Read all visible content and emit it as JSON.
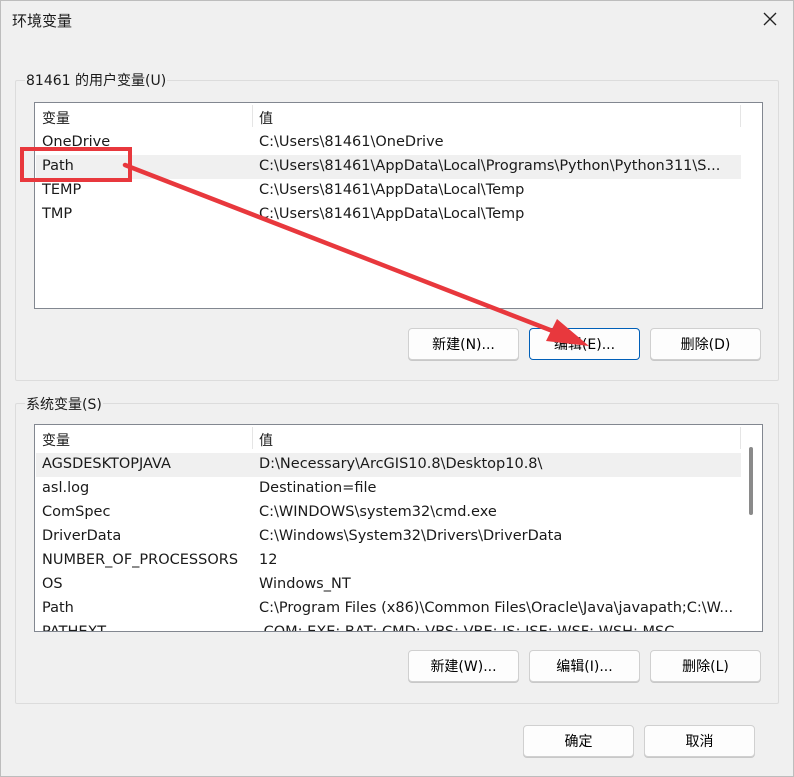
{
  "window": {
    "title": "环境变量"
  },
  "user_vars": {
    "group_label": "81461 的用户变量(U)",
    "columns": [
      "变量",
      "值"
    ],
    "rows": [
      {
        "name": "OneDrive",
        "value": "C:\\Users\\81461\\OneDrive"
      },
      {
        "name": "Path",
        "value": "C:\\Users\\81461\\AppData\\Local\\Programs\\Python\\Python311\\S..."
      },
      {
        "name": "TEMP",
        "value": "C:\\Users\\81461\\AppData\\Local\\Temp"
      },
      {
        "name": "TMP",
        "value": "C:\\Users\\81461\\AppData\\Local\\Temp"
      }
    ],
    "buttons": {
      "new": "新建(N)...",
      "edit": "编辑(E)...",
      "delete": "删除(D)"
    }
  },
  "system_vars": {
    "group_label": "系统变量(S)",
    "columns": [
      "变量",
      "值"
    ],
    "rows": [
      {
        "name": "AGSDESKTOPJAVA",
        "value": "D:\\Necessary\\ArcGIS10.8\\Desktop10.8\\"
      },
      {
        "name": "asl.log",
        "value": "Destination=file"
      },
      {
        "name": "ComSpec",
        "value": "C:\\WINDOWS\\system32\\cmd.exe"
      },
      {
        "name": "DriverData",
        "value": "C:\\Windows\\System32\\Drivers\\DriverData"
      },
      {
        "name": "NUMBER_OF_PROCESSORS",
        "value": "12"
      },
      {
        "name": "OS",
        "value": "Windows_NT"
      },
      {
        "name": "Path",
        "value": "C:\\Program Files (x86)\\Common Files\\Oracle\\Java\\javapath;C:\\W..."
      },
      {
        "name": "PATHEXT",
        "value": ".COM;.EXE;.BAT;.CMD;.VBS;.VBE;.JS;.JSE;.WSF;.WSH;.MSC"
      }
    ],
    "buttons": {
      "new": "新建(W)...",
      "edit": "编辑(I)...",
      "delete": "删除(L)"
    }
  },
  "footer": {
    "ok": "确定",
    "cancel": "取消"
  },
  "colors": {
    "annotation": "#e8383d",
    "focus_border": "#005fb8"
  },
  "icons": {
    "close": "close-icon"
  }
}
